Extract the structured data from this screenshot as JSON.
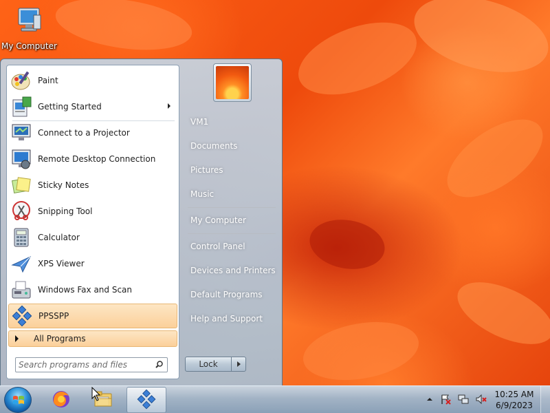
{
  "desktop": {
    "icons": [
      {
        "label": "My Computer",
        "icon": "computer-icon"
      }
    ]
  },
  "start_menu": {
    "programs": [
      {
        "label": "Paint",
        "icon": "paint-icon",
        "has_submenu": false
      },
      {
        "label": "Getting Started",
        "icon": "getting-started-icon",
        "has_submenu": true
      },
      {
        "label": "Connect to a Projector",
        "icon": "projector-icon",
        "has_submenu": false
      },
      {
        "label": "Remote Desktop Connection",
        "icon": "remote-desktop-icon",
        "has_submenu": false
      },
      {
        "label": "Sticky Notes",
        "icon": "sticky-notes-icon",
        "has_submenu": false
      },
      {
        "label": "Snipping Tool",
        "icon": "snipping-tool-icon",
        "has_submenu": false
      },
      {
        "label": "Calculator",
        "icon": "calculator-icon",
        "has_submenu": false
      },
      {
        "label": "XPS Viewer",
        "icon": "xps-viewer-icon",
        "has_submenu": false
      },
      {
        "label": "Windows Fax and Scan",
        "icon": "fax-scan-icon",
        "has_submenu": false
      },
      {
        "label": "PPSSPP",
        "icon": "ppsspp-icon",
        "has_submenu": false,
        "selected": true
      }
    ],
    "all_programs_label": "All Programs",
    "search": {
      "placeholder": "Search programs and files",
      "value": ""
    },
    "right_items": [
      {
        "label": "VM1"
      },
      {
        "label": "Documents"
      },
      {
        "label": "Pictures"
      },
      {
        "label": "Music"
      },
      {
        "label": "My Computer"
      },
      {
        "label": "Control Panel"
      },
      {
        "label": "Devices and Printers"
      },
      {
        "label": "Default Programs"
      },
      {
        "label": "Help and Support"
      }
    ],
    "shutdown_label": "Lock"
  },
  "taskbar": {
    "items": [
      {
        "icon": "start-orb-icon"
      },
      {
        "icon": "firefox-icon"
      },
      {
        "icon": "file-explorer-icon"
      },
      {
        "icon": "ppsspp-icon",
        "active": true
      }
    ],
    "tray_icons": [
      "show-hidden-icons-icon",
      "action-center-flag-icon",
      "network-icon",
      "volume-muted-icon"
    ],
    "clock": {
      "time": "10:25 AM",
      "date": "6/9/2023"
    }
  },
  "colors": {
    "wallpaper": "#f25a10",
    "selection": "#fbd09a",
    "taskbar": "#9eb7ce"
  }
}
